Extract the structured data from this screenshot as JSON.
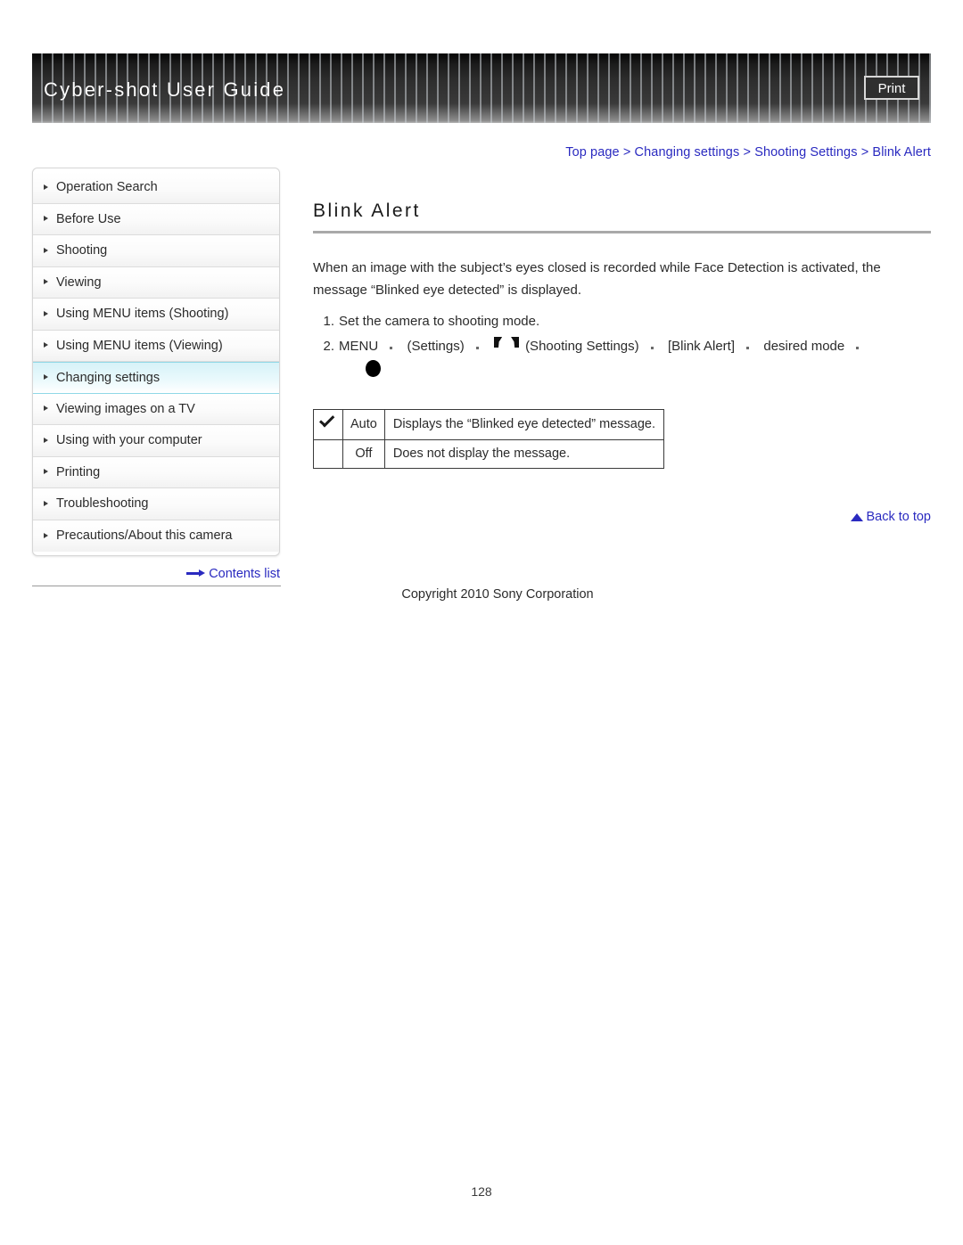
{
  "header": {
    "title": "Cyber-shot User Guide",
    "print_label": "Print"
  },
  "breadcrumb": {
    "items": [
      "Top page",
      "Changing settings",
      "Shooting Settings",
      "Blink Alert"
    ],
    "separator": ">",
    "full": "Top page > Changing settings > Shooting Settings > Blink Alert"
  },
  "sidebar": {
    "items": [
      {
        "label": "Operation Search",
        "active": false
      },
      {
        "label": "Before Use",
        "active": false
      },
      {
        "label": "Shooting",
        "active": false
      },
      {
        "label": "Viewing",
        "active": false
      },
      {
        "label": "Using MENU items (Shooting)",
        "active": false
      },
      {
        "label": "Using MENU items (Viewing)",
        "active": false
      },
      {
        "label": "Changing settings",
        "active": true
      },
      {
        "label": "Viewing images on a TV",
        "active": false
      },
      {
        "label": "Using with your computer",
        "active": false
      },
      {
        "label": "Printing",
        "active": false
      },
      {
        "label": "Troubleshooting",
        "active": false
      },
      {
        "label": "Precautions/About this camera",
        "active": false
      }
    ],
    "contents_link": "Contents list"
  },
  "main": {
    "title": "Blink Alert",
    "intro": "When an image with the subject’s eyes closed is recorded while Face Detection is activated, the message “Blinked eye detected” is displayed.",
    "steps": [
      {
        "num": "1",
        "text": "Set the camera to shooting mode."
      }
    ],
    "step2": {
      "num": "2",
      "menu_label": "MENU",
      "settings_label": "(Settings)",
      "shooting_settings_label": "(Shooting Settings)",
      "blink_alert_label": "[Blink Alert]",
      "desired_mode_label": "desired mode"
    },
    "table": {
      "rows": [
        {
          "checked": true,
          "name": "Auto",
          "description": "Displays the “Blinked eye detected” message."
        },
        {
          "checked": false,
          "name": "Off",
          "description": "Does not display the message."
        }
      ]
    },
    "back_to_top": "Back to top",
    "copyright": "Copyright 2010 Sony Corporation",
    "page_number": "128"
  },
  "colors": {
    "link": "#2a2ac0",
    "highlight": "#d6f2f8",
    "banner_dark": "#2e2e2e"
  }
}
